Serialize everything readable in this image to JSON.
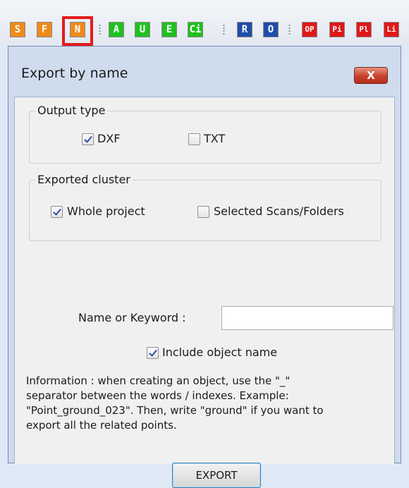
{
  "toolbar": {
    "buttons": [
      {
        "label": "S",
        "color": "#f08a1a"
      },
      {
        "label": "F",
        "color": "#f08a1a"
      },
      {
        "label": "N",
        "color": "#f08a1a"
      },
      {
        "label": "A",
        "color": "#20c020"
      },
      {
        "label": "U",
        "color": "#20c020"
      },
      {
        "label": "E",
        "color": "#20c020"
      },
      {
        "label": "Ci",
        "color": "#20c020"
      },
      {
        "label": "R",
        "color": "#1f4ea8"
      },
      {
        "label": "O",
        "color": "#1f4ea8"
      },
      {
        "label": "OP",
        "color": "#e01818"
      },
      {
        "label": "Pi",
        "color": "#e01818"
      },
      {
        "label": "Pl",
        "color": "#e01818"
      },
      {
        "label": "Li",
        "color": "#e01818"
      }
    ],
    "highlight_color": "#e31b1b"
  },
  "dialog": {
    "title": "Export by name",
    "close_label": "X",
    "output_type": {
      "legend": "Output type",
      "options": [
        {
          "label": "DXF",
          "checked": true
        },
        {
          "label": "TXT",
          "checked": false
        }
      ]
    },
    "exported_cluster": {
      "legend": "Exported cluster",
      "options": [
        {
          "label": "Whole project",
          "checked": true
        },
        {
          "label": "Selected Scans/Folders",
          "checked": false
        }
      ]
    },
    "name_label": "Name or Keyword :",
    "name_value": "",
    "include_label": "Include object name",
    "include_checked": true,
    "info_lines": [
      "Information : when creating an object, use the \"_\"",
      "separator between the words / indexes. Example:",
      "\"Point_ground_023\". Then, write \"ground\" if you want to",
      "export all the related points."
    ],
    "export_label": "EXPORT"
  }
}
